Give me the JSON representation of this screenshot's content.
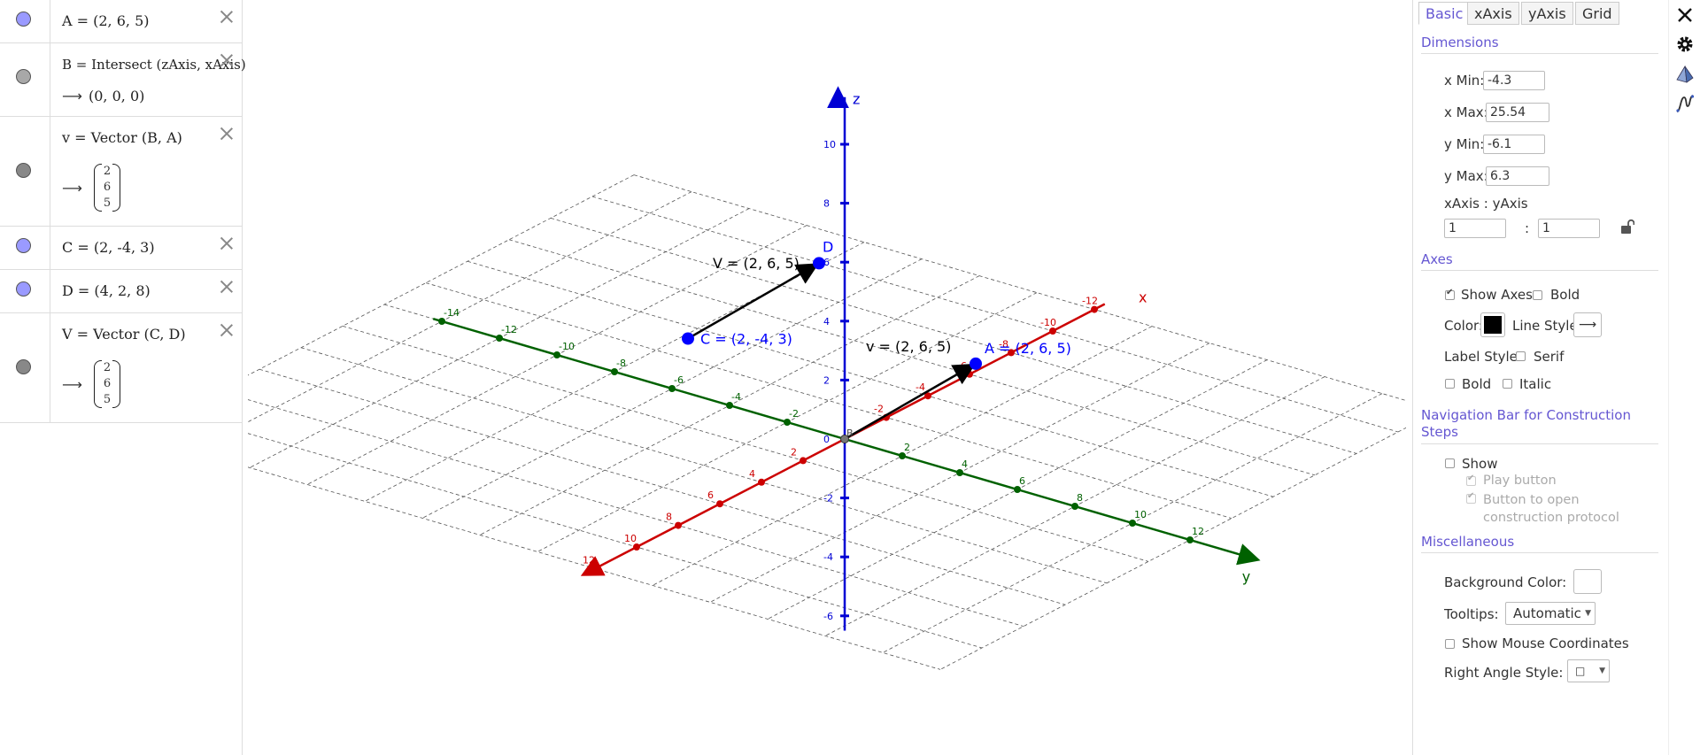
{
  "algebra": {
    "items": [
      {
        "id": "A",
        "def": "A = (2, 6, 5)",
        "result": null,
        "marble": "#9a9aff"
      },
      {
        "id": "B",
        "def": "B = Intersect (zAxis, xAxis)",
        "result": "(0, 0, 0)",
        "marble": "#a8a8a8"
      },
      {
        "id": "v",
        "def": "v = Vector (B, A)",
        "result": [
          "2",
          "6",
          "5"
        ],
        "marble": "#888888"
      },
      {
        "id": "C",
        "def": "C = (2, -4, 3)",
        "result": null,
        "marble": "#9a9aff"
      },
      {
        "id": "D",
        "def": "D = (4, 2, 8)",
        "result": null,
        "marble": "#9a9aff"
      },
      {
        "id": "V",
        "def": "V = Vector (C, D)",
        "result": [
          "2",
          "6",
          "5"
        ],
        "marble": "#888888"
      }
    ],
    "arrow_glyph": "⟶"
  },
  "graphics": {
    "axis_labels": {
      "x": "x",
      "y": "y",
      "z": "z"
    },
    "z_ticks": [
      "10",
      "8",
      "6",
      "4",
      "2",
      "0",
      "-2",
      "-4",
      "-6"
    ],
    "y_ticks_pos": [
      "2",
      "4",
      "6",
      "8",
      "10",
      "12"
    ],
    "y_ticks_neg": [
      "-2",
      "-4",
      "-6",
      "-8",
      "-10",
      "-12",
      "-14"
    ],
    "x_ticks_pos": [
      "2",
      "4",
      "6",
      "8",
      "10",
      "12"
    ],
    "x_ticks_neg": [
      "-2",
      "-4",
      "-6",
      "-8",
      "-10",
      "-12"
    ],
    "labels": {
      "A": "A = (2, 6, 5)",
      "C": "C = (2, -4, 3)",
      "D": "D",
      "v": "v = (2, 6, 5)",
      "V": "V = (2, 6, 5)",
      "B": "B"
    },
    "colors": {
      "x": "#cc0000",
      "y": "#006100",
      "z": "#0000d4",
      "point": "#0000ff",
      "vector": "#000000"
    }
  },
  "properties": {
    "tabs": [
      "Basic",
      "xAxis",
      "yAxis",
      "Grid"
    ],
    "active_tab": "Basic",
    "dimensions": {
      "title": "Dimensions",
      "xmin_label": "x Min:",
      "xmin": "-4.3",
      "xmax_label": "x Max:",
      "xmax": "25.54",
      "ymin_label": "y Min:",
      "ymin": "-6.1",
      "ymax_label": "y Max:",
      "ymax": "6.3",
      "ratio_label": "xAxis : yAxis",
      "ratio_x": "1",
      "ratio_sep": ":",
      "ratio_y": "1"
    },
    "axes": {
      "title": "Axes",
      "show_axes": "Show Axes",
      "show_axes_checked": true,
      "bold": "Bold",
      "bold_checked": false,
      "color_label": "Color:",
      "color": "#000000",
      "line_style_label": "Line Style:",
      "line_style_value": "⟶",
      "label_style": "Label Style:",
      "serif": "Serif",
      "label_bold": "Bold",
      "italic": "Italic"
    },
    "navigation": {
      "title": "Navigation Bar for Construction Steps",
      "show": "Show",
      "play": "Play button",
      "open_protocol": "Button to open construction protocol"
    },
    "misc": {
      "title": "Miscellaneous",
      "bg_color": "Background Color:",
      "tooltips": "Tooltips:",
      "tooltips_value": "Automatic",
      "mouse_coords": "Show Mouse Coordinates",
      "right_angle": "Right Angle Style:",
      "right_angle_value": "□"
    }
  },
  "sidebar": {
    "icons": [
      "close-icon",
      "gear-icon",
      "pyramid-icon",
      "function-icon"
    ]
  }
}
